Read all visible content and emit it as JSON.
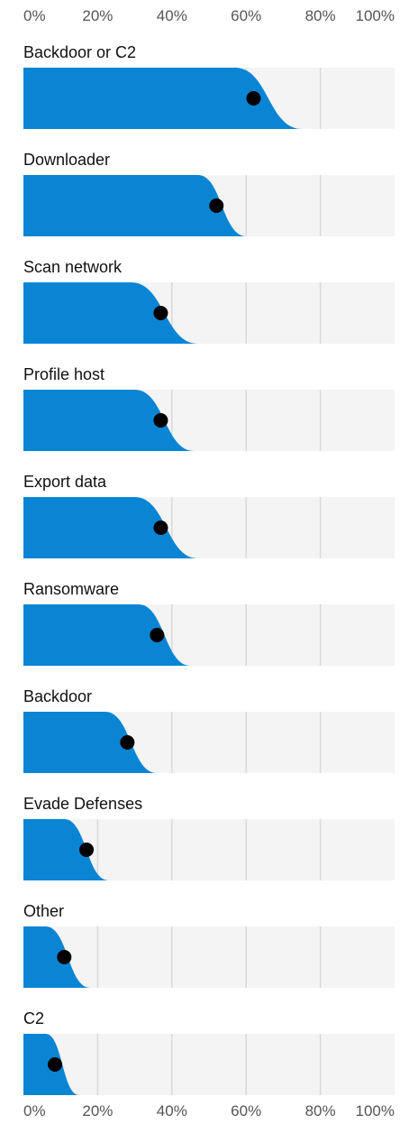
{
  "chart_data": {
    "type": "area",
    "xlabel": "",
    "ylabel": "",
    "x_ticks": [
      "0%",
      "20%",
      "40%",
      "60%",
      "80%",
      "100%"
    ],
    "xlim": [
      0,
      100
    ],
    "grid": true,
    "colors": {
      "fill": "#0a85d4",
      "panel_bg": "#f4f4f4",
      "grid": "#d9d9d9",
      "marker": "#000000"
    },
    "series": [
      {
        "name": "Backdoor or C2",
        "marker": 62,
        "start": 57,
        "end": 75
      },
      {
        "name": "Downloader",
        "marker": 52,
        "start": 47,
        "end": 60
      },
      {
        "name": "Scan network",
        "marker": 37,
        "start": 29,
        "end": 47
      },
      {
        "name": "Profile host",
        "marker": 37,
        "start": 30,
        "end": 46
      },
      {
        "name": "Export data",
        "marker": 37,
        "start": 30,
        "end": 47
      },
      {
        "name": "Ransomware",
        "marker": 36,
        "start": 31,
        "end": 45
      },
      {
        "name": "Backdoor",
        "marker": 28,
        "start": 22,
        "end": 36
      },
      {
        "name": "Evade Defenses",
        "marker": 17,
        "start": 11,
        "end": 23
      },
      {
        "name": "Other",
        "marker": 11,
        "start": 6,
        "end": 18
      },
      {
        "name": "C2",
        "marker": 8.5,
        "start": 6,
        "end": 15
      }
    ]
  }
}
